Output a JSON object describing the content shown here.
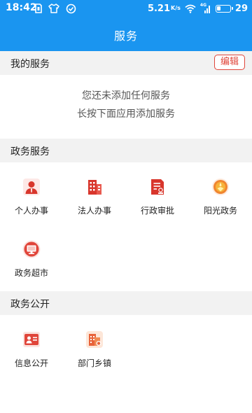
{
  "status_bar": {
    "time": "18:42",
    "net_speed": "5.21",
    "net_speed_unit": "K/s",
    "signal_label": "4G",
    "battery": "29",
    "battery_level": 0.29
  },
  "header": {
    "title": "服务"
  },
  "my_services": {
    "title": "我的服务",
    "edit_label": "编辑",
    "empty_line1": "您还未添加任何服务",
    "empty_line2": "长按下面应用添加服务"
  },
  "gov_services": {
    "title": "政务服务",
    "items": [
      {
        "label": "个人办事",
        "icon": "person-icon"
      },
      {
        "label": "法人办事",
        "icon": "building-icon"
      },
      {
        "label": "行政审批",
        "icon": "document-stamp-icon"
      },
      {
        "label": "阳光政务",
        "icon": "sun-icon"
      },
      {
        "label": "政务超市",
        "icon": "monitor-icon"
      }
    ]
  },
  "gov_public": {
    "title": "政务公开",
    "items": [
      {
        "label": "信息公开",
        "icon": "id-card-icon"
      },
      {
        "label": "部门乡镇",
        "icon": "office-building-icon"
      }
    ]
  },
  "colors": {
    "accent": "#1a95f0",
    "red": "#e0453a",
    "orange": "#f39c12"
  }
}
